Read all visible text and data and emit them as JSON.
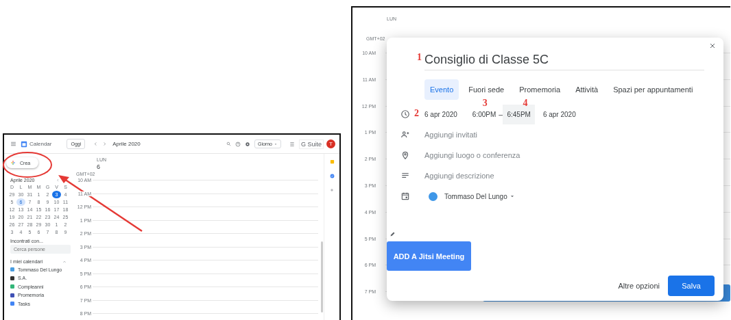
{
  "left_screenshot": {
    "header": {
      "app_name": "Calendar",
      "today_button": "Oggi",
      "period": "Aprile 2020",
      "view_select": "Giorno",
      "suite_label": "G Suite",
      "avatar_letter": "T"
    },
    "create_button": "Crea",
    "mini_calendar": {
      "title": "Aprile 2020",
      "weekdays": [
        "D",
        "L",
        "M",
        "M",
        "G",
        "V",
        "S"
      ],
      "weeks": [
        [
          {
            "day": "29",
            "today": false,
            "selected": false
          },
          {
            "day": "30",
            "today": false,
            "selected": false
          },
          {
            "day": "31",
            "today": false,
            "selected": false
          },
          {
            "day": "1",
            "today": false,
            "selected": false
          },
          {
            "day": "2",
            "today": false,
            "selected": false
          },
          {
            "day": "3",
            "today": true,
            "selected": false
          },
          {
            "day": "4",
            "today": false,
            "selected": false
          }
        ],
        [
          {
            "day": "5",
            "today": false,
            "selected": false
          },
          {
            "day": "6",
            "today": false,
            "selected": true
          },
          {
            "day": "7",
            "today": false,
            "selected": false
          },
          {
            "day": "8",
            "today": false,
            "selected": false
          },
          {
            "day": "9",
            "today": false,
            "selected": false
          },
          {
            "day": "10",
            "today": false,
            "selected": false
          },
          {
            "day": "11",
            "today": false,
            "selected": false
          }
        ],
        [
          {
            "day": "12",
            "today": false,
            "selected": false
          },
          {
            "day": "13",
            "today": false,
            "selected": false
          },
          {
            "day": "14",
            "today": false,
            "selected": false
          },
          {
            "day": "15",
            "today": false,
            "selected": false
          },
          {
            "day": "16",
            "today": false,
            "selected": false
          },
          {
            "day": "17",
            "today": false,
            "selected": false
          },
          {
            "day": "18",
            "today": false,
            "selected": false
          }
        ],
        [
          {
            "day": "19",
            "today": false,
            "selected": false
          },
          {
            "day": "20",
            "today": false,
            "selected": false
          },
          {
            "day": "21",
            "today": false,
            "selected": false
          },
          {
            "day": "22",
            "today": false,
            "selected": false
          },
          {
            "day": "23",
            "today": false,
            "selected": false
          },
          {
            "day": "24",
            "today": false,
            "selected": false
          },
          {
            "day": "25",
            "today": false,
            "selected": false
          }
        ],
        [
          {
            "day": "26",
            "today": false,
            "selected": false
          },
          {
            "day": "27",
            "today": false,
            "selected": false
          },
          {
            "day": "28",
            "today": false,
            "selected": false
          },
          {
            "day": "29",
            "today": false,
            "selected": false
          },
          {
            "day": "30",
            "today": false,
            "selected": false
          },
          {
            "day": "1",
            "today": false,
            "selected": false
          },
          {
            "day": "2",
            "today": false,
            "selected": false
          }
        ],
        [
          {
            "day": "3",
            "today": false,
            "selected": false
          },
          {
            "day": "4",
            "today": false,
            "selected": false
          },
          {
            "day": "5",
            "today": false,
            "selected": false
          },
          {
            "day": "6",
            "today": false,
            "selected": false
          },
          {
            "day": "7",
            "today": false,
            "selected": false
          },
          {
            "day": "8",
            "today": false,
            "selected": false
          },
          {
            "day": "9",
            "today": false,
            "selected": false
          }
        ]
      ]
    },
    "meet_with": {
      "title": "Incontrati con...",
      "placeholder": "Cerca persone"
    },
    "my_calendars": {
      "title": "I miei calendari",
      "expanded": true,
      "items": [
        {
          "name": "Tommaso Del Lungo",
          "checked": true,
          "color": "#4a9de0"
        },
        {
          "name": "S.A.",
          "checked": true,
          "color": "#333333"
        },
        {
          "name": "Compleanni",
          "checked": true,
          "color": "#33b679"
        },
        {
          "name": "Promemoria",
          "checked": true,
          "color": "#3f51b5"
        },
        {
          "name": "Tasks",
          "checked": true,
          "color": "#4285f4"
        }
      ]
    },
    "day_header": {
      "weekday": "LUN",
      "date": "6"
    },
    "timezone": "GMT+02",
    "hours": [
      "10 AM",
      "11 AM",
      "12 PM",
      "1 PM",
      "2 PM",
      "3 PM",
      "4 PM",
      "5 PM",
      "6 PM",
      "7 PM",
      "8 PM"
    ]
  },
  "right_screenshot": {
    "day_header": {
      "weekday": "LUN"
    },
    "timezone": "GMT+02",
    "hours": [
      "10 AM",
      "11 AM",
      "12 PM",
      "1 PM",
      "2 PM",
      "3 PM",
      "4 PM",
      "5 PM",
      "6 PM",
      "7 PM"
    ],
    "dialog": {
      "title": "Consiglio di Classe 5C",
      "tabs": [
        {
          "label": "Evento",
          "selected": true
        },
        {
          "label": "Fuori sede",
          "selected": false
        },
        {
          "label": "Promemoria",
          "selected": false
        },
        {
          "label": "Attività",
          "selected": false
        },
        {
          "label": "Spazi per appuntamenti",
          "selected": false
        }
      ],
      "start_date": "6 apr 2020",
      "start_time": "6:00PM",
      "separator": "–",
      "end_time": "6:45PM",
      "end_time_focused": true,
      "end_date": "6 apr 2020",
      "guests_placeholder": "Aggiungi invitati",
      "location_placeholder": "Aggiungi luogo o conferenza",
      "description_placeholder": "Aggiungi descrizione",
      "calendar": {
        "name": "Tommaso Del Lungo",
        "color": "#3f97e8"
      },
      "jitsi_button": "ADD A Jitsi Meeting",
      "more_options": "Altre opzioni",
      "save_button": "Salva"
    },
    "markers": [
      "1",
      "2",
      "3",
      "4"
    ]
  }
}
